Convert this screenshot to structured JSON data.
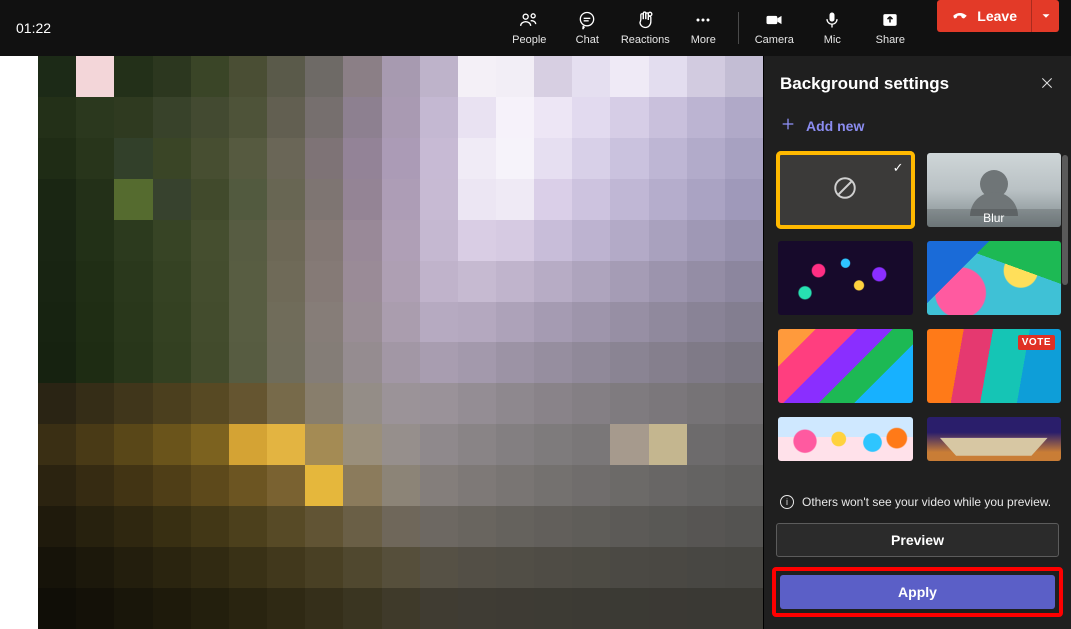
{
  "topbar": {
    "timer": "01:22",
    "items": [
      {
        "id": "people",
        "label": "People"
      },
      {
        "id": "chat",
        "label": "Chat"
      },
      {
        "id": "reactions",
        "label": "Reactions"
      },
      {
        "id": "more",
        "label": "More"
      },
      {
        "id": "camera",
        "label": "Camera"
      },
      {
        "id": "mic",
        "label": "Mic"
      },
      {
        "id": "share",
        "label": "Share"
      }
    ],
    "leave_label": "Leave"
  },
  "panel": {
    "title": "Background settings",
    "add_new_label": "Add new",
    "tiles": {
      "none_selected": true,
      "blur_label": "Blur",
      "vote_badge": "VOTE"
    },
    "info_text": "Others won't see your video while you preview.",
    "preview_label": "Preview",
    "apply_label": "Apply"
  }
}
